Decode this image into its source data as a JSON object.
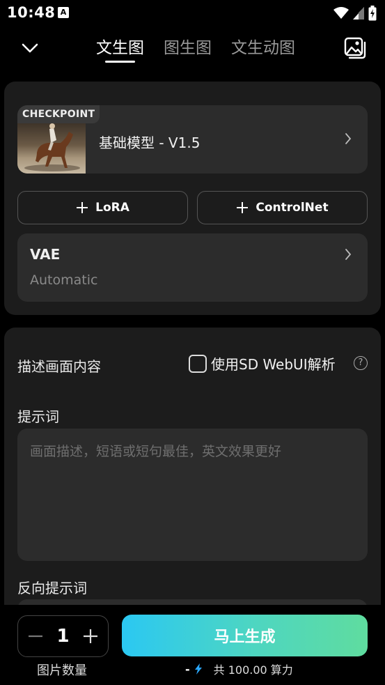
{
  "status_bar": {
    "time": "10:48",
    "a_icon_letter": "A"
  },
  "header": {
    "tabs": [
      {
        "label": "文生图",
        "active": true
      },
      {
        "label": "图生图",
        "active": false
      },
      {
        "label": "文生动图",
        "active": false
      }
    ]
  },
  "model": {
    "badge": "CHECKPOINT",
    "name": "基础模型 - V1.5"
  },
  "buttons": {
    "lora_label": "LoRA",
    "controlnet_label": "ControlNet"
  },
  "vae": {
    "title": "VAE",
    "value": "Automatic"
  },
  "prompt_section": {
    "describe_title": "描述画面内容",
    "webui_label": "使用SD WebUI解析",
    "webui_checked": false,
    "help_symbol": "?",
    "prompt_title": "提示词",
    "prompt_placeholder": "画面描述，短语或短句最佳，英文效果更好",
    "prompt_value": "",
    "negative_title": "反向提示词"
  },
  "bottom": {
    "quantity": "1",
    "quantity_label": "图片数量",
    "generate_label": "马上生成",
    "cost_prefix": "-",
    "cost_text": "共 100.00 算力"
  },
  "colors": {
    "background": "#000000",
    "card": "#1c1c1c",
    "field": "#2c2c2c",
    "generate_gradient_start": "#2bc8f2",
    "generate_gradient_end": "#5fdc9f",
    "bolt": "#2aa8ff"
  }
}
